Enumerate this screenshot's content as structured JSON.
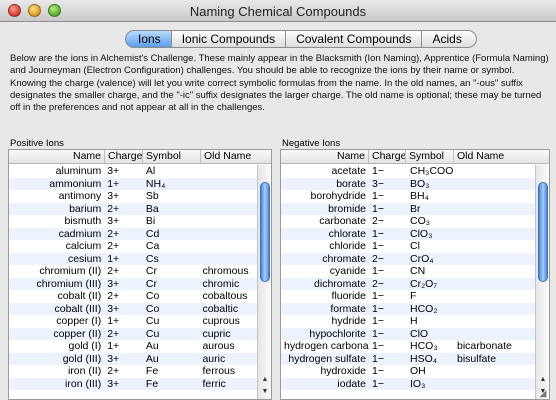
{
  "window": {
    "title": "Naming Chemical Compounds"
  },
  "tabs": [
    {
      "label": "Ions",
      "active": true
    },
    {
      "label": "Ionic Compounds",
      "active": false
    },
    {
      "label": "Covalent Compounds",
      "active": false
    },
    {
      "label": "Acids",
      "active": false
    }
  ],
  "description": "Below are the ions in Alchemist's Challenge.  These mainly appear in the Blacksmith (Ion Naming), Apprentice (Formula Naming) and Journeyman (Electron Configuration) challenges.  You should be able to recognize the ions by their name or symbol.  Knowing the charge (valence) will let you write correct symbolic formulas from the name.  In the old names, an \"-ous\" suffix designates the smaller charge, and the \"-ic\" suffix designates the larger charge.  The old name is optional; these may be turned off in the preferences and not appear at all in the challenges.",
  "positive": {
    "label": "Positive Ions",
    "columns": {
      "name": "Name",
      "charge": "Charge",
      "symbol": "Symbol",
      "old": "Old Name"
    },
    "rows": [
      {
        "name": "aluminum",
        "charge": "3+",
        "symbol": "Al",
        "old": ""
      },
      {
        "name": "ammonium",
        "charge": "1+",
        "symbol": "NH₄",
        "old": ""
      },
      {
        "name": "antimony",
        "charge": "3+",
        "symbol": "Sb",
        "old": ""
      },
      {
        "name": "barium",
        "charge": "2+",
        "symbol": "Ba",
        "old": ""
      },
      {
        "name": "bismuth",
        "charge": "3+",
        "symbol": "Bi",
        "old": ""
      },
      {
        "name": "cadmium",
        "charge": "2+",
        "symbol": "Cd",
        "old": ""
      },
      {
        "name": "calcium",
        "charge": "2+",
        "symbol": "Ca",
        "old": ""
      },
      {
        "name": "cesium",
        "charge": "1+",
        "symbol": "Cs",
        "old": ""
      },
      {
        "name": "chromium (II)",
        "charge": "2+",
        "symbol": "Cr",
        "old": "chromous"
      },
      {
        "name": "chromium (III)",
        "charge": "3+",
        "symbol": "Cr",
        "old": "chromic"
      },
      {
        "name": "cobalt (II)",
        "charge": "2+",
        "symbol": "Co",
        "old": "cobaltous"
      },
      {
        "name": "cobalt (III)",
        "charge": "3+",
        "symbol": "Co",
        "old": "cobaltic"
      },
      {
        "name": "copper (I)",
        "charge": "1+",
        "symbol": "Cu",
        "old": "cuprous"
      },
      {
        "name": "copper (II)",
        "charge": "2+",
        "symbol": "Cu",
        "old": "cupric"
      },
      {
        "name": "gold (I)",
        "charge": "1+",
        "symbol": "Au",
        "old": "aurous"
      },
      {
        "name": "gold (III)",
        "charge": "3+",
        "symbol": "Au",
        "old": "auric"
      },
      {
        "name": "iron (II)",
        "charge": "2+",
        "symbol": "Fe",
        "old": "ferrous"
      },
      {
        "name": "iron (III)",
        "charge": "3+",
        "symbol": "Fe",
        "old": "ferric"
      }
    ]
  },
  "negative": {
    "label": "Negative Ions",
    "columns": {
      "name": "Name",
      "charge": "Charge",
      "symbol": "Symbol",
      "old": "Old Name"
    },
    "rows": [
      {
        "name": "acetate",
        "charge": "1−",
        "symbol": "CH₃COO",
        "old": ""
      },
      {
        "name": "borate",
        "charge": "3−",
        "symbol": "BO₃",
        "old": ""
      },
      {
        "name": "borohydride",
        "charge": "1−",
        "symbol": "BH₄",
        "old": ""
      },
      {
        "name": "bromide",
        "charge": "1−",
        "symbol": "Br",
        "old": ""
      },
      {
        "name": "carbonate",
        "charge": "2−",
        "symbol": "CO₃",
        "old": ""
      },
      {
        "name": "chlorate",
        "charge": "1−",
        "symbol": "ClO₃",
        "old": ""
      },
      {
        "name": "chloride",
        "charge": "1−",
        "symbol": "Cl",
        "old": ""
      },
      {
        "name": "chromate",
        "charge": "2−",
        "symbol": "CrO₄",
        "old": ""
      },
      {
        "name": "cyanide",
        "charge": "1−",
        "symbol": "CN",
        "old": ""
      },
      {
        "name": "dichromate",
        "charge": "2−",
        "symbol": "Cr₂O₇",
        "old": ""
      },
      {
        "name": "fluoride",
        "charge": "1−",
        "symbol": "F",
        "old": ""
      },
      {
        "name": "formate",
        "charge": "1−",
        "symbol": "HCO₂",
        "old": ""
      },
      {
        "name": "hydride",
        "charge": "1−",
        "symbol": "H",
        "old": ""
      },
      {
        "name": "hypochlorite",
        "charge": "1−",
        "symbol": "ClO",
        "old": ""
      },
      {
        "name": "hydrogen carbonate",
        "charge": "1−",
        "symbol": "HCO₃",
        "old": "bicarbonate"
      },
      {
        "name": "hydrogen sulfate",
        "charge": "1−",
        "symbol": "HSO₄",
        "old": "bisulfate"
      },
      {
        "name": "hydroxide",
        "charge": "1−",
        "symbol": "OH",
        "old": ""
      },
      {
        "name": "iodate",
        "charge": "1−",
        "symbol": "IO₃",
        "old": ""
      }
    ]
  }
}
